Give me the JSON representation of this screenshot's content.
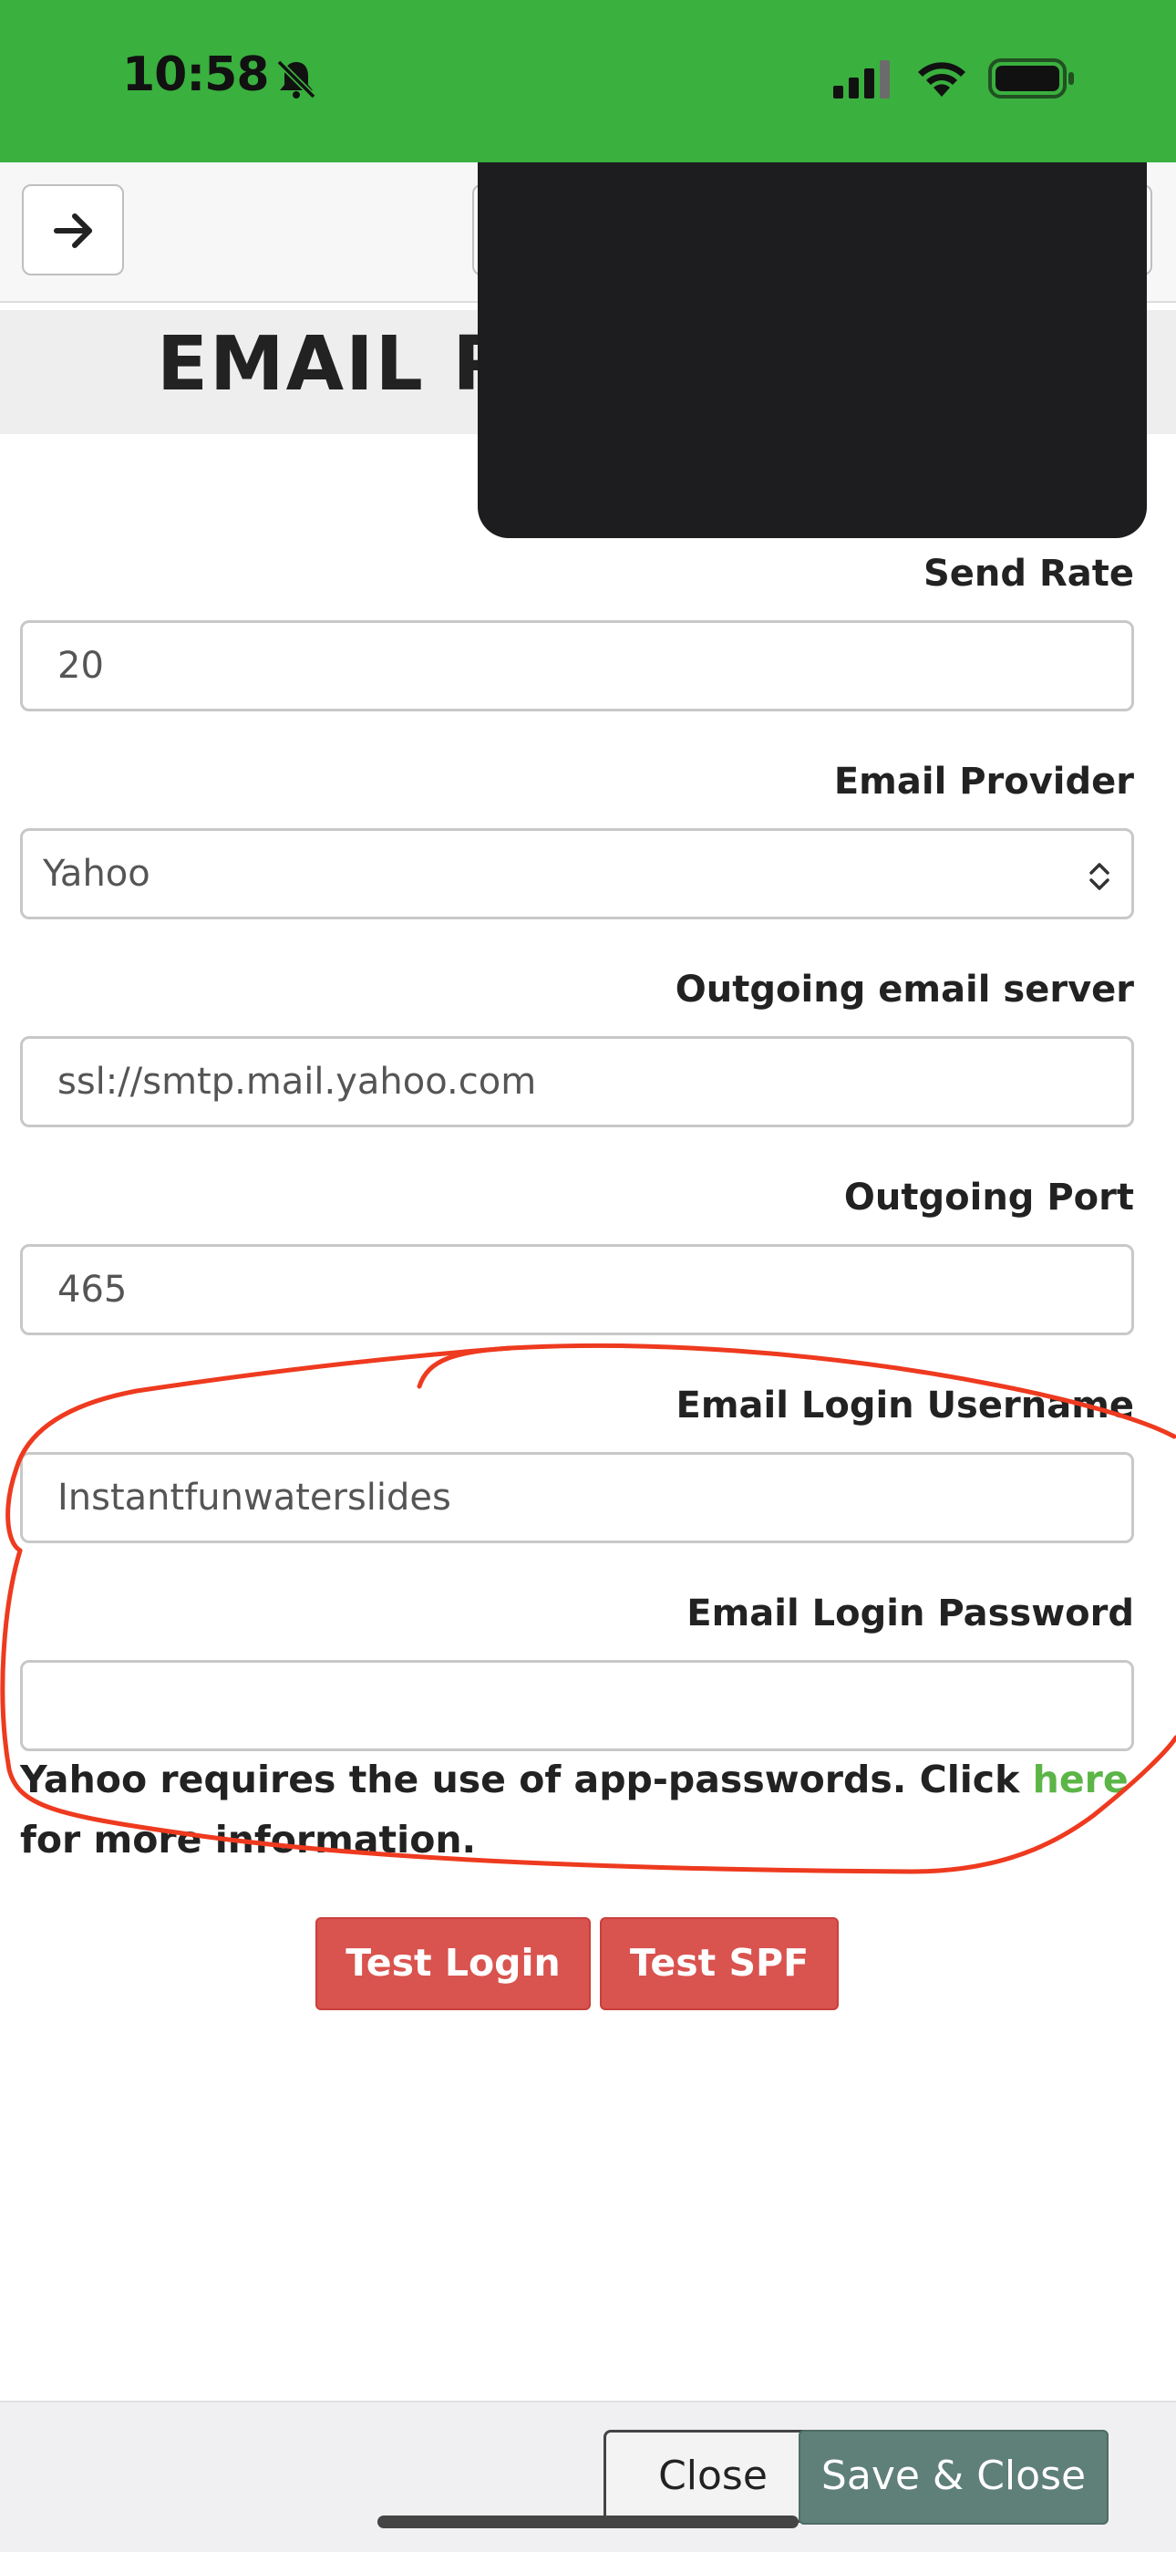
{
  "status_bar": {
    "time": "10:58",
    "icons": [
      "bell-slash-icon",
      "signal-icon",
      "wifi-icon",
      "battery-icon"
    ]
  },
  "toolbar": {
    "nav_icon": "arrow-right-icon"
  },
  "page": {
    "heading": "EMAIL P"
  },
  "form": {
    "send_rate": {
      "label": "Send Rate",
      "value": "20"
    },
    "email_provider": {
      "label": "Email Provider",
      "value": "Yahoo"
    },
    "outgoing_server": {
      "label": "Outgoing email server",
      "value": "ssl://smtp.mail.yahoo.com"
    },
    "outgoing_port": {
      "label": "Outgoing Port",
      "value": "465"
    },
    "login_username": {
      "label": "Email Login Username",
      "value": "Instantfunwaterslides"
    },
    "login_password": {
      "label": "Email Login Password",
      "value": ""
    },
    "help": {
      "before": "Yahoo requires the use of app-passwords. Click ",
      "link": "here",
      "after": " for more information."
    }
  },
  "buttons": {
    "test_login": "Test Login",
    "test_spf": "Test SPF",
    "close": "Close",
    "save_close": "Save & Close"
  },
  "colors": {
    "status_bar": "#3ab03e",
    "danger": "#d9534f",
    "save": "#5f7f79",
    "link": "#5bb547",
    "annotation": "#ee3a1f",
    "redaction": "#1d1d1f"
  }
}
